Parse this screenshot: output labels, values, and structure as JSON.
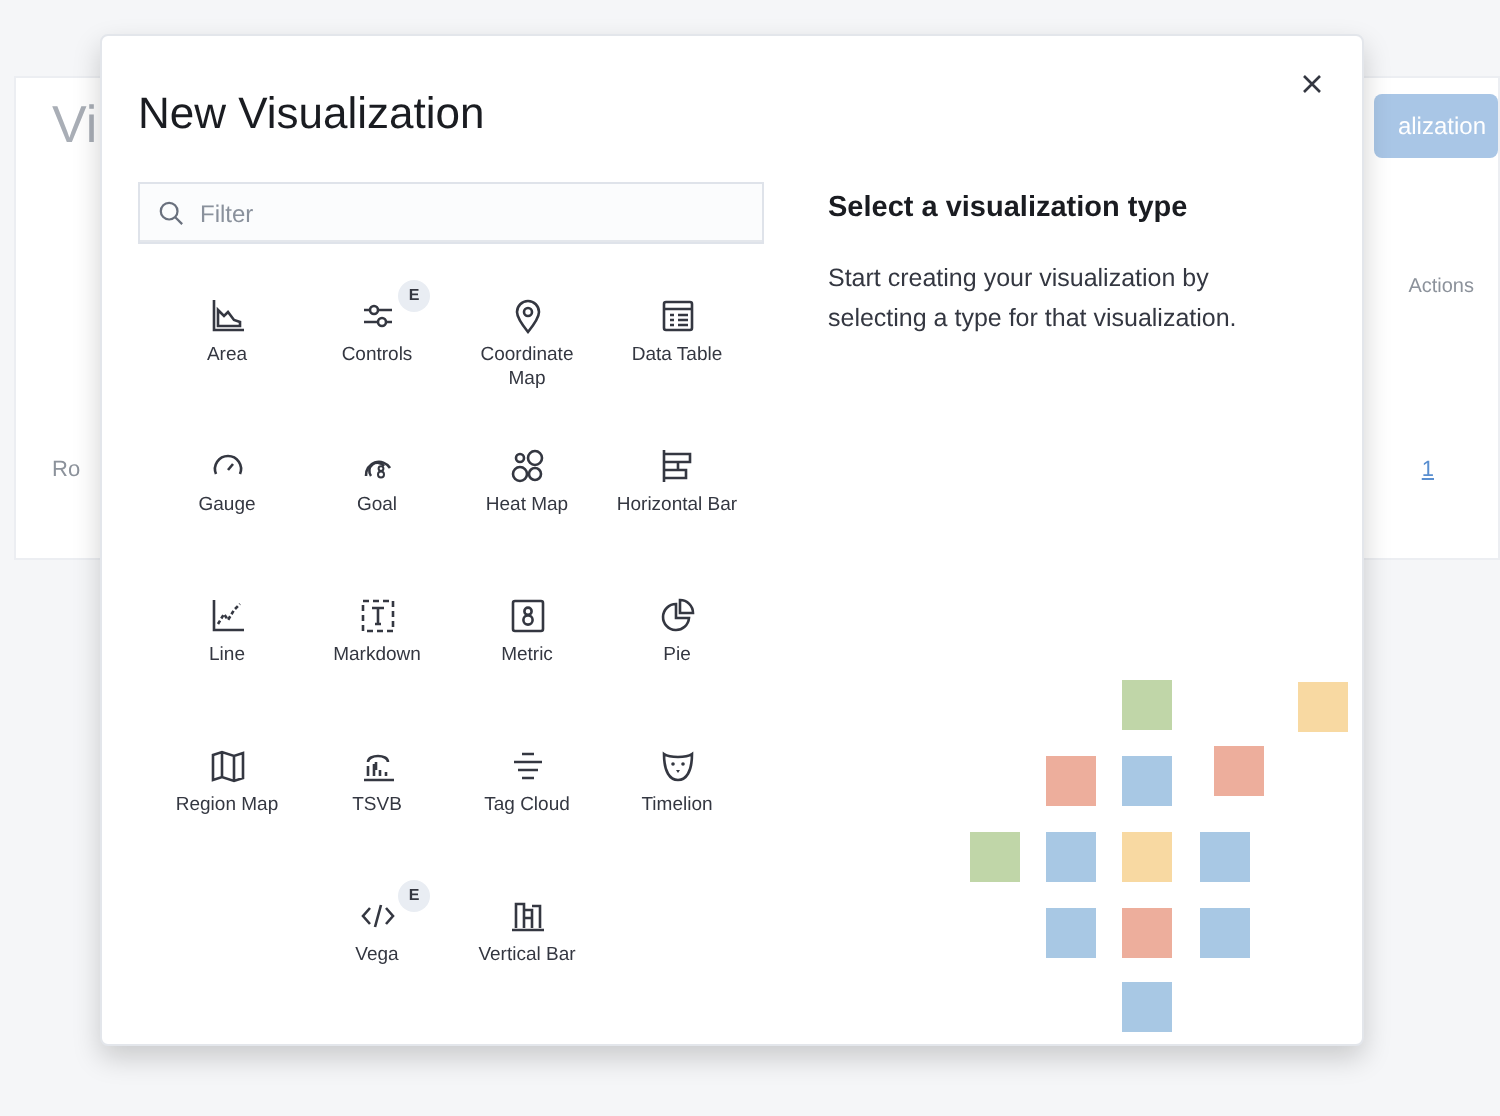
{
  "background_page": {
    "title": "Vi",
    "create_button": "alization",
    "column_header": "Actions",
    "footer_label": "Ro",
    "page_number": "1"
  },
  "modal": {
    "title": "New Visualization",
    "filter": {
      "placeholder": "Filter"
    },
    "types": [
      {
        "kind": "area",
        "label": "Area"
      },
      {
        "kind": "controls",
        "label": "Controls",
        "badge": "E"
      },
      {
        "kind": "coordinate_map",
        "label": "Coordinate Map"
      },
      {
        "kind": "data_table",
        "label": "Data Table"
      },
      {
        "kind": "gauge",
        "label": "Gauge"
      },
      {
        "kind": "goal",
        "label": "Goal"
      },
      {
        "kind": "heat_map",
        "label": "Heat Map"
      },
      {
        "kind": "horizontal_bar",
        "label": "Horizontal Bar"
      },
      {
        "kind": "line",
        "label": "Line"
      },
      {
        "kind": "markdown",
        "label": "Markdown"
      },
      {
        "kind": "metric",
        "label": "Metric"
      },
      {
        "kind": "pie",
        "label": "Pie"
      },
      {
        "kind": "region_map",
        "label": "Region Map"
      },
      {
        "kind": "tsvb",
        "label": "TSVB"
      },
      {
        "kind": "tag_cloud",
        "label": "Tag Cloud"
      },
      {
        "kind": "timelion",
        "label": "Timelion"
      },
      {
        "kind": "vega",
        "label": "Vega",
        "badge": "E"
      },
      {
        "kind": "vertical_bar",
        "label": "Vertical Bar"
      }
    ],
    "description": {
      "heading": "Select a visualization type",
      "text": "Start creating your visualization by selecting a type for that visualization."
    }
  }
}
